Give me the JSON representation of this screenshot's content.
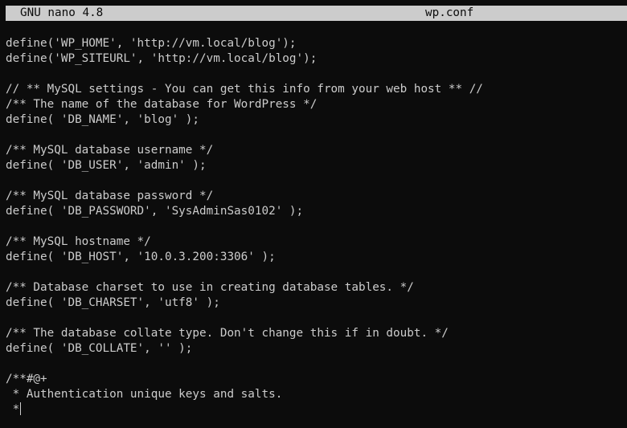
{
  "header": {
    "program": "GNU nano 4.8",
    "filename": "wp.conf"
  },
  "editor": {
    "lines": [
      "define('WP_HOME', 'http://vm.local/blog');",
      "define('WP_SITEURL', 'http://vm.local/blog');",
      "",
      "// ** MySQL settings - You can get this info from your web host ** //",
      "/** The name of the database for WordPress */",
      "define( 'DB_NAME', 'blog' );",
      "",
      "/** MySQL database username */",
      "define( 'DB_USER', 'admin' );",
      "",
      "/** MySQL database password */",
      "define( 'DB_PASSWORD', 'SysAdminSas0102' );",
      "",
      "/** MySQL hostname */",
      "define( 'DB_HOST', '10.0.3.200:3306' );",
      "",
      "/** Database charset to use in creating database tables. */",
      "define( 'DB_CHARSET', 'utf8' );",
      "",
      "/** The database collate type. Don't change this if in doubt. */",
      "define( 'DB_COLLATE', '' );",
      "",
      "/**#@+",
      " * Authentication unique keys and salts.",
      " *"
    ]
  }
}
